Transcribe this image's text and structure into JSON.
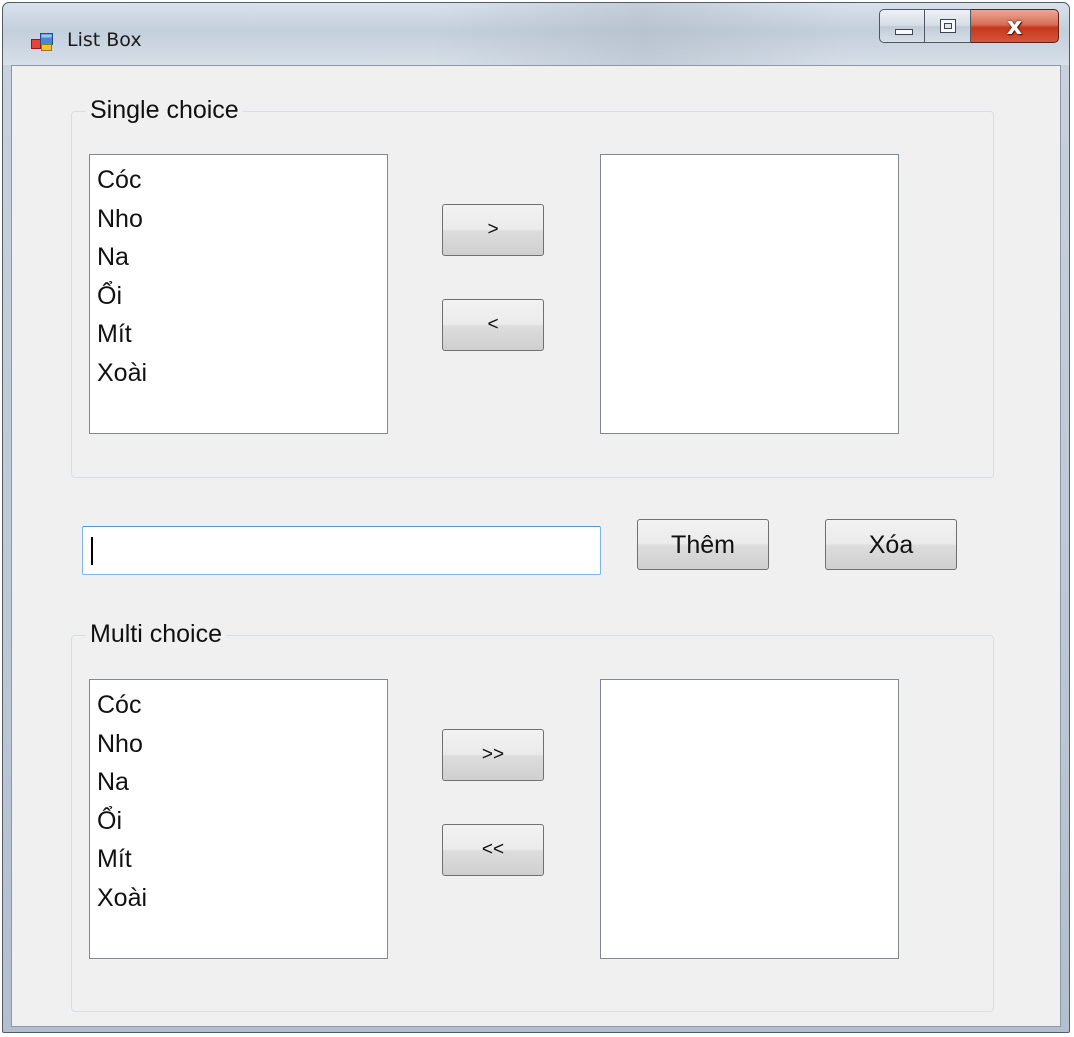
{
  "window": {
    "title": "List Box"
  },
  "icons": {
    "app": "windows-form-icon",
    "minimize": "minimize-icon",
    "maximize": "maximize-icon",
    "close": "close-icon"
  },
  "single_group": {
    "title": "Single choice",
    "source_items": [
      "Cóc",
      "Nho",
      "Na",
      "Ổi",
      "Mít",
      "Xoài"
    ],
    "target_items": [],
    "move_right_label": ">",
    "move_left_label": "<"
  },
  "input": {
    "value": "",
    "add_label": "Thêm",
    "delete_label": "Xóa"
  },
  "multi_group": {
    "title": "Multi choice",
    "source_items": [
      "Cóc",
      "Nho",
      "Na",
      "Ổi",
      "Mít",
      "Xoài"
    ],
    "target_items": [],
    "move_all_right_label": ">>",
    "move_all_left_label": "<<"
  },
  "colors": {
    "client_background": "#f0f0f0",
    "close_button": "#c7371a",
    "textbox_focus_border": "#7eb4ea"
  }
}
